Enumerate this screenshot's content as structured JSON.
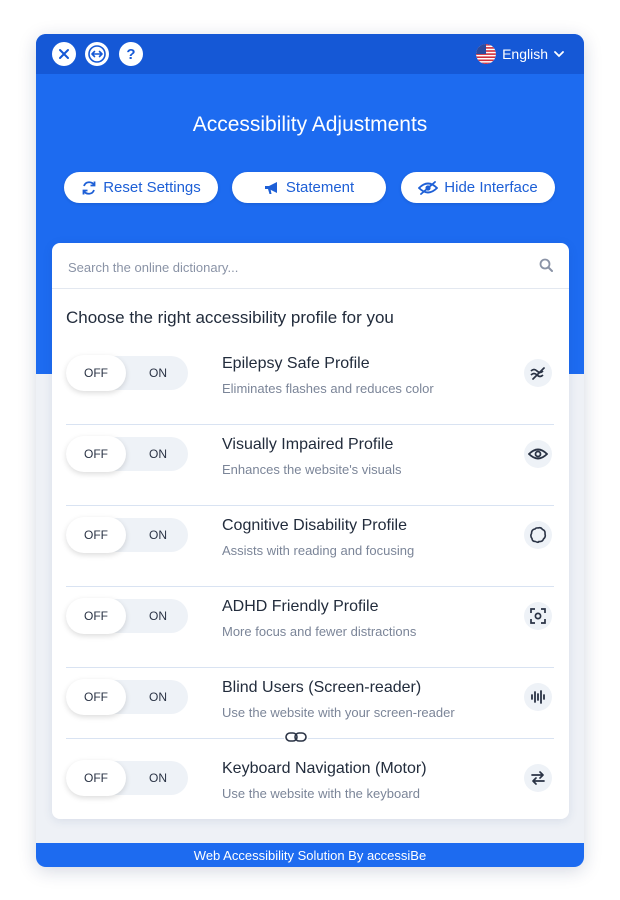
{
  "topbar": {
    "close_icon": "close-icon",
    "resize_icon": "resize-arrows-icon",
    "help_icon": "help-icon",
    "help_label": "?",
    "language": {
      "label": "English",
      "flag": "us-flag-icon"
    }
  },
  "header": {
    "title": "Accessibility Adjustments"
  },
  "actions": [
    {
      "label": "Reset Settings",
      "icon": "reset-icon"
    },
    {
      "label": "Statement",
      "icon": "megaphone-icon"
    },
    {
      "label": "Hide Interface",
      "icon": "eye-slash-icon"
    }
  ],
  "search": {
    "placeholder": "Search the online dictionary..."
  },
  "profiles_heading": "Choose the right accessibility profile for you",
  "toggle": {
    "off_label": "OFF",
    "on_label": "ON"
  },
  "profiles": [
    {
      "title": "Epilepsy Safe Profile",
      "description": "Eliminates flashes and reduces color",
      "icon": "waves-icon",
      "state": "off"
    },
    {
      "title": "Visually Impaired Profile",
      "description": "Enhances the website's visuals",
      "icon": "eye-icon",
      "state": "off"
    },
    {
      "title": "Cognitive Disability Profile",
      "description": "Assists with reading and focusing",
      "icon": "brain-icon",
      "state": "off"
    },
    {
      "title": "ADHD Friendly Profile",
      "description": "More focus and fewer distractions",
      "icon": "focus-target-icon",
      "state": "off"
    },
    {
      "title": "Blind Users (Screen-reader)",
      "description": "Use the website with your screen-reader",
      "icon": "audio-wave-icon",
      "state": "off"
    },
    {
      "title": "Keyboard Navigation (Motor)",
      "description": "Use the website with the keyboard",
      "icon": "swap-arrows-icon",
      "state": "off"
    }
  ],
  "footer": {
    "text": "Web Accessibility Solution By accessiBe"
  },
  "colors": {
    "primary": "#1d6bf0",
    "topbar": "#1558d6",
    "background": "#eef1f6"
  }
}
